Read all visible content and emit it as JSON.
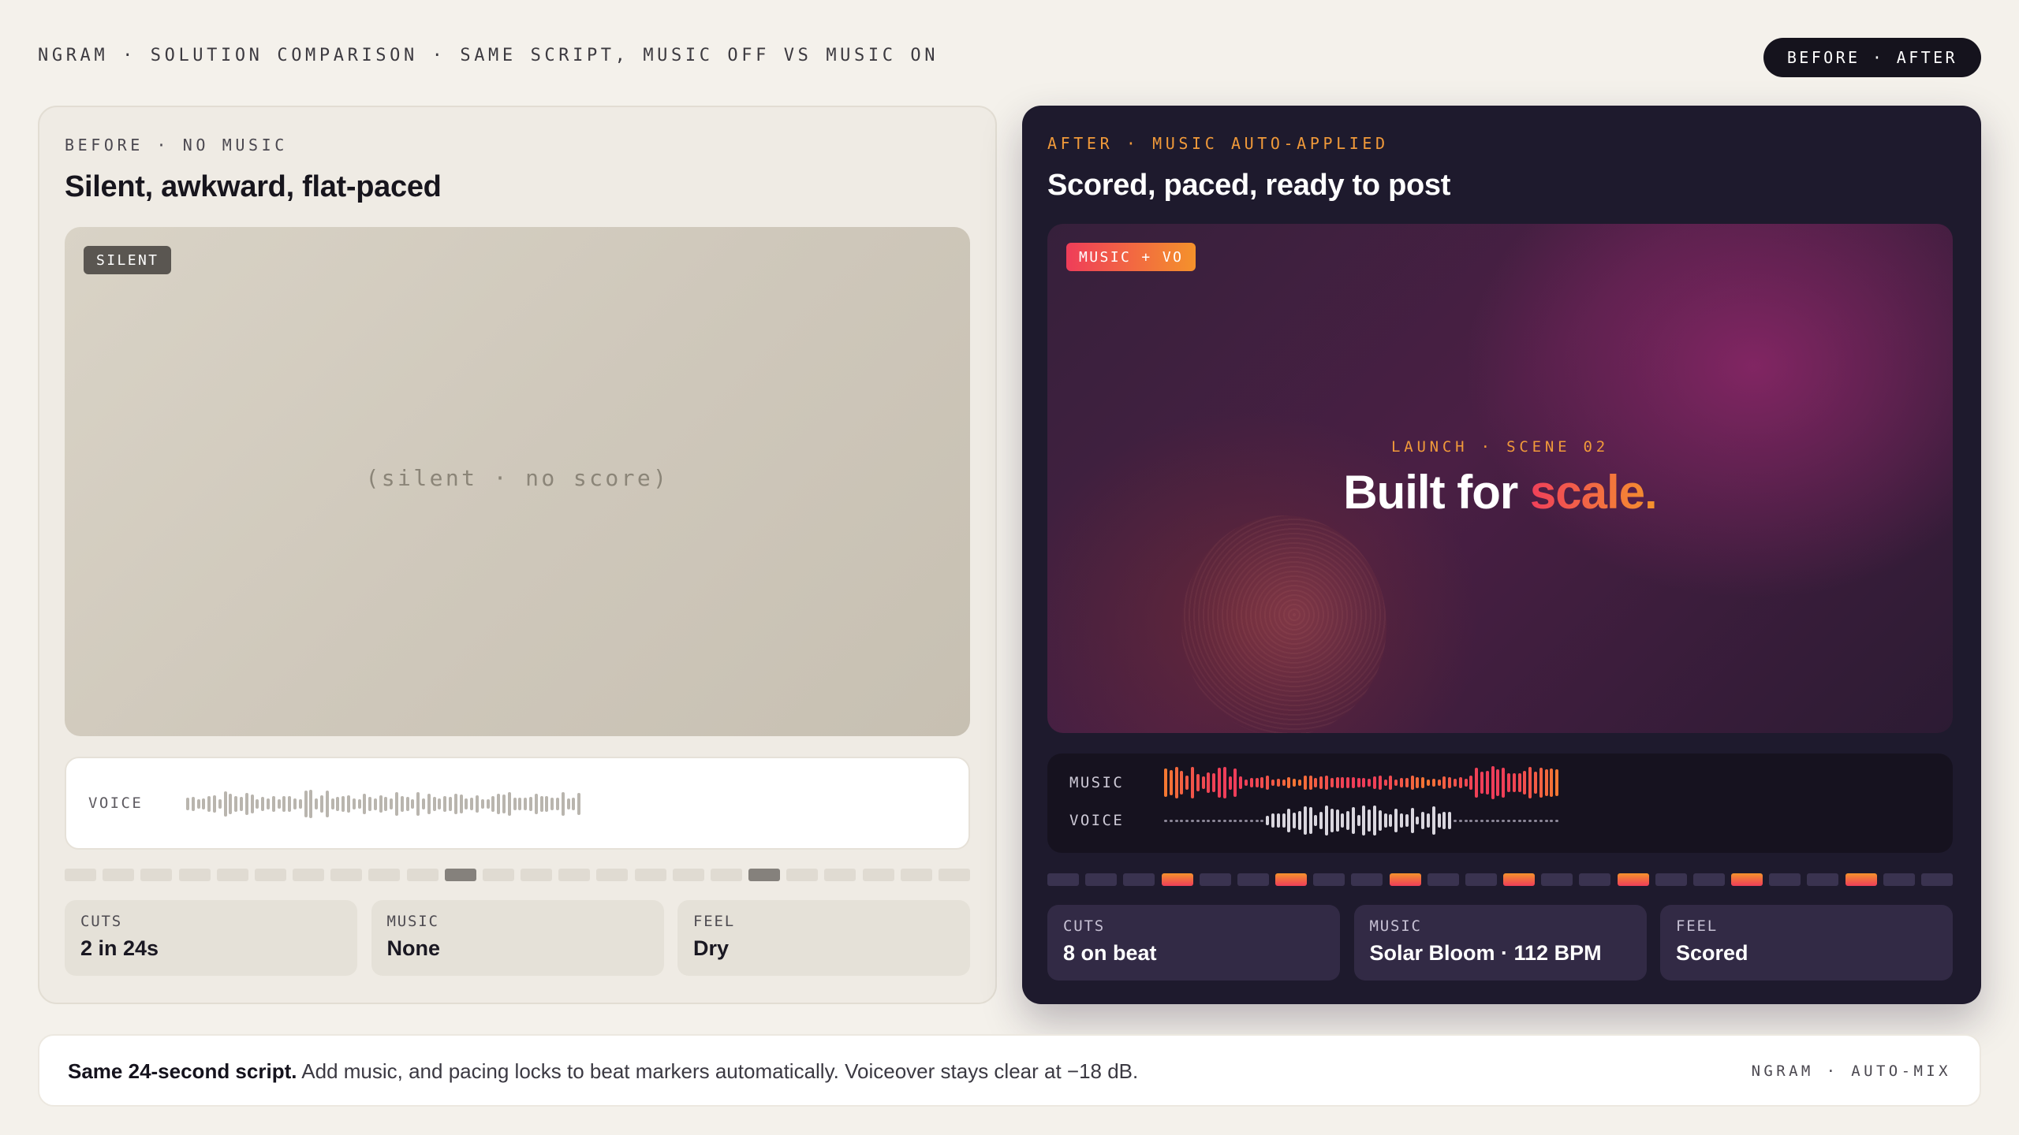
{
  "header": {
    "title": "NGRAM · SOLUTION COMPARISON · SAME SCRIPT, MUSIC OFF VS MUSIC ON",
    "toggle_label": "BEFORE · AFTER"
  },
  "before": {
    "eyebrow": "BEFORE · NO MUSIC",
    "headline": "Silent, awkward, flat-paced",
    "badge": "SILENT",
    "placeholder": "(silent · no score)",
    "voice_label": "VOICE",
    "beat_highlights": [
      10,
      18
    ],
    "stats": [
      {
        "label": "CUTS",
        "value": "2 in 24s"
      },
      {
        "label": "MUSIC",
        "value": "None"
      },
      {
        "label": "FEEL",
        "value": "Dry"
      }
    ]
  },
  "after": {
    "eyebrow": "AFTER · MUSIC AUTO-APPLIED",
    "headline": "Scored, paced, ready to post",
    "badge": "MUSIC + VO",
    "scene_label": "LAUNCH · SCENE 02",
    "scene_title_main": "Built for",
    "scene_title_accent": "scale.",
    "music_label": "MUSIC",
    "voice_label": "VOICE",
    "beat_highlights": [
      3,
      6,
      9,
      12,
      15,
      18,
      21
    ],
    "stats": [
      {
        "label": "CUTS",
        "value": "8 on beat"
      },
      {
        "label": "MUSIC",
        "value": "Solar Bloom · 112 BPM"
      },
      {
        "label": "FEEL",
        "value": "Scored"
      }
    ]
  },
  "footer": {
    "lead": "Same 24-second script.",
    "body": "Add music, and pacing locks to beat markers automatically. Voiceover stays clear at −18 dB.",
    "right": "NGRAM · AUTO-MIX"
  },
  "colors": {
    "accent_orange": "#f19a3a",
    "accent_red": "#ef3d59",
    "dark_panel": "#1e1a2d",
    "light_panel": "#efebe4"
  }
}
